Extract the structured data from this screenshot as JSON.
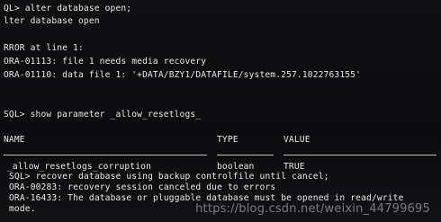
{
  "terminal": {
    "lines": [
      "QL> alter database open;",
      "lter database open",
      "",
      "RROR at line 1:",
      "ORA-01113: file 1 needs media recovery",
      "ORA-01110: data file 1: '+DATA/BZY1/DATAFILE/system.257.1022763155'",
      "",
      "",
      "SQL> show parameter _allow_resetlogs_"
    ],
    "table": {
      "headers": [
        "NAME",
        "TYPE",
        "VALUE"
      ],
      "row": [
        "_allow_resetlogs_corruption",
        "boolean",
        "TRUE"
      ]
    },
    "tail_lines": [
      "SQL> recover database using backup controlfile until cancel;",
      "ORA-00283: recovery session canceled due to errors",
      "ORA-16433: The database or pluggable database must be opened in read/write",
      "mode."
    ]
  },
  "watermark": "https://blog.csdn.net/weixin_44799695"
}
